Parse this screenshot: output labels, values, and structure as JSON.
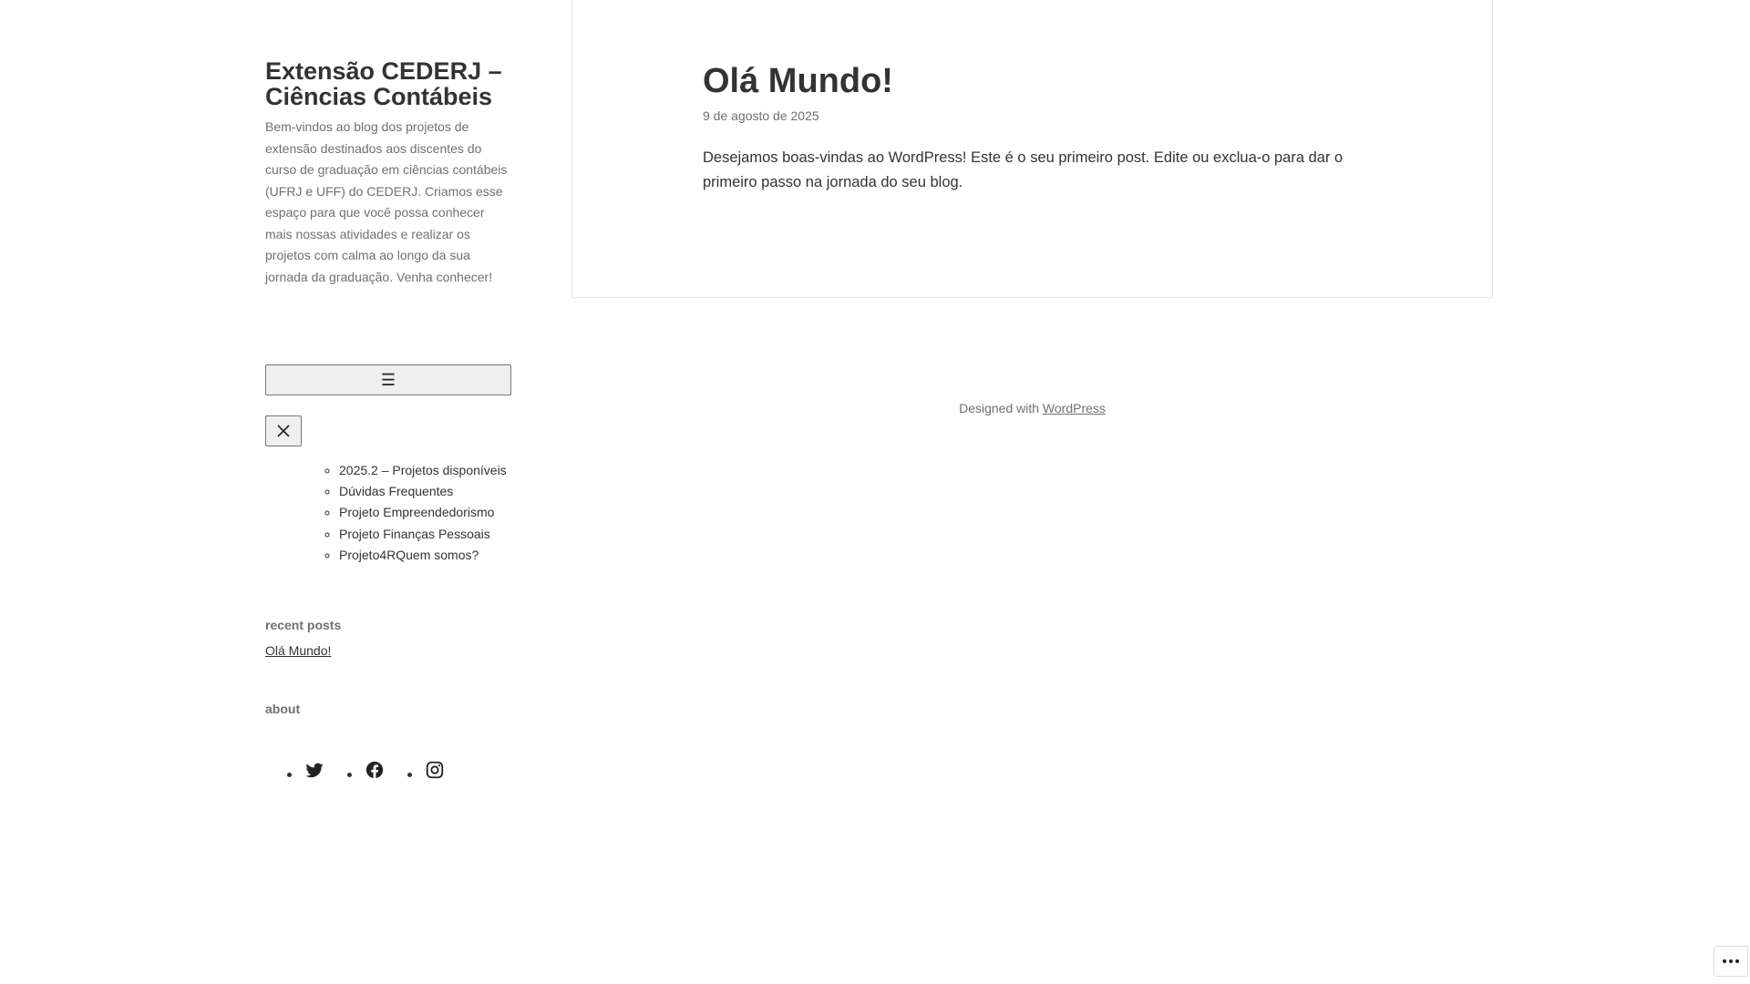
{
  "site": {
    "title": "Extensão CEDERJ – Ciências Contábeis",
    "description": "Bem-vindos ao blog dos projetos de extensão destinados aos discentes do curso de graduação em ciências contábeis (UFRJ e UFF) do CEDERJ. Criamos esse espaço para que você possa conhecer mais nossas atividades e realizar os projetos com calma ao longo da sua jornada da graduação. Venha conhecer!"
  },
  "menu": {
    "toggle_glyph": "☰",
    "close_icon": "close-icon",
    "items": [
      {
        "label": "2025.2 – Projetos disponíveis"
      },
      {
        "label": "Dúvidas Frequentes"
      },
      {
        "label": "Projeto Empreendedorismo"
      },
      {
        "label": "Projeto Finanças Pessoais"
      },
      {
        "label": "Projeto4RQuem somos?"
      }
    ]
  },
  "widgets": {
    "recent_title": "recent posts",
    "recent_posts": [
      {
        "label": "Olá Mundo!"
      }
    ],
    "about_title": "about",
    "social_icons": [
      "twitter-icon",
      "facebook-icon",
      "instagram-icon"
    ]
  },
  "post": {
    "title": "Olá Mundo!",
    "date": "9 de agosto de 2025",
    "body": "Desejamos boas-vindas ao WordPress! Este é o seu primeiro post. Edite ou exclua-o para dar o primeiro passo na jornada do seu blog."
  },
  "footer": {
    "prefix": "Designed with",
    "link": "WordPress"
  }
}
